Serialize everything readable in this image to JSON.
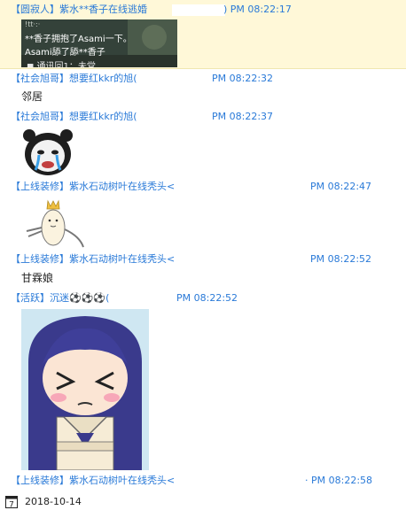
{
  "messages": [
    {
      "name": "【圆寂人】紫水**香子在线逃婚",
      "time": ") PM 08:22:17"
    },
    {
      "name": "【社会旭哥】想要红kkr的旭(",
      "time": "PM 08:22:32",
      "text": "邻居"
    },
    {
      "name": "【社会旭哥】想要红kkr的旭(",
      "time": "PM 08:22:37"
    },
    {
      "name": "【上线装修】紫水石动树叶在线秃头<",
      "time": "PM 08:22:47"
    },
    {
      "name": "【上线装修】紫水石动树叶在线秃头<",
      "time": "PM 08:22:52",
      "text": "甘霖娘"
    },
    {
      "name": "【活跃】沉迷⚽⚽⚽(",
      "time": "PM 08:22:52"
    },
    {
      "name": "【上线装修】紫水石动树叶在线秃头<",
      "time": "· PM 08:22:58"
    }
  ],
  "game_capture": {
    "line0": "!tt·:·",
    "line1": "**香子拥抱了Asami一下。",
    "line2": "Asami舔了舔**香子",
    "line3": "◼ 通讯回1：未党"
  },
  "footer": {
    "date": "2018-10-14",
    "icon": "calendar-icon",
    "icon_glyph": "7"
  },
  "colors": {
    "name_blue": "#2a7ad8",
    "highlight": "#fff8d8"
  }
}
